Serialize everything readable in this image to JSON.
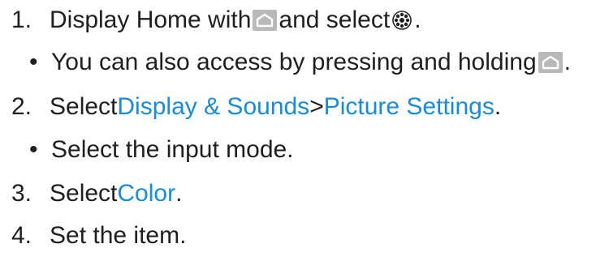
{
  "steps": [
    {
      "num": "1.",
      "pre": "Display Home with ",
      "mid": " and select ",
      "end": "."
    },
    {
      "bullet": "•",
      "pre": "You can also access by pressing and holding ",
      "end": "."
    },
    {
      "num": "2.",
      "pre": "Select ",
      "link1": "Display & Sounds",
      "sep": " > ",
      "link2": "Picture Settings",
      "end": "."
    },
    {
      "bullet": "•",
      "text": "Select the input mode."
    },
    {
      "num": "3.",
      "pre": "Select ",
      "link": "Color",
      "end": "."
    },
    {
      "num": "4.",
      "text": "Set the item."
    }
  ],
  "icons": {
    "home": "home-icon",
    "settings": "gear-icon"
  },
  "colors": {
    "link": "#1a8bd6",
    "text": "#1f1f1f",
    "icon_bg": "#b9b9b9"
  }
}
